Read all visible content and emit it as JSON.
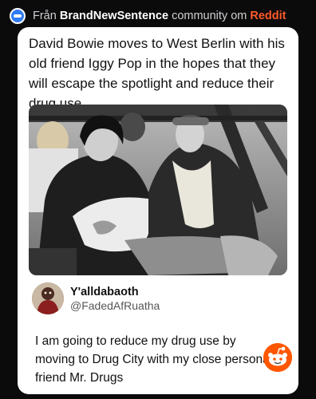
{
  "header": {
    "prefix": "Från",
    "community": "BrandNewSentence",
    "middle": "community om",
    "platform": "Reddit",
    "icon": "subreddit-icon"
  },
  "post": {
    "title": "David Bowie moves to West Berlin with his old friend Iggy Pop in the hopes that they will escape the spotlight and reduce their drug use."
  },
  "tweet": {
    "display_name": "Y'alldabaoth",
    "handle": "@FadedAfRuatha",
    "text": "I am going to reduce my drug use by moving to Drug City with my close personal friend Mr. Drugs"
  },
  "footer": {
    "icon": "reddit-snoo-icon"
  }
}
